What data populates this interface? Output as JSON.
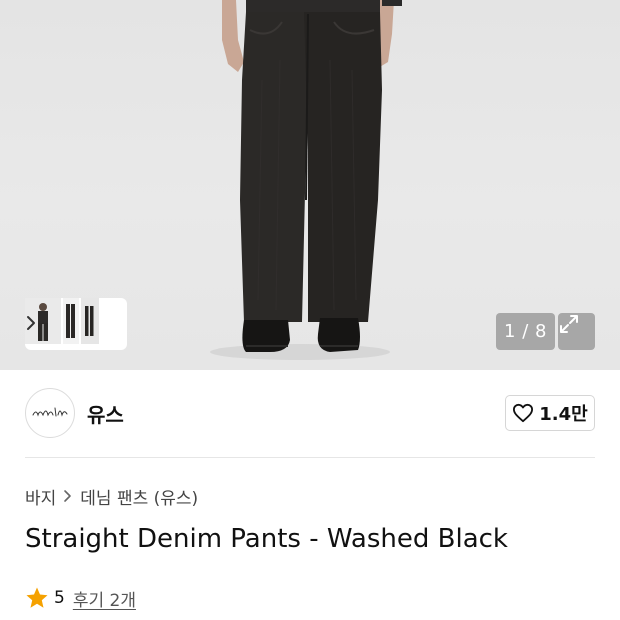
{
  "gallery": {
    "counter": "1 / 8"
  },
  "brand": {
    "logo_text": "nyouth",
    "name": "유스",
    "like_count": "1.4만"
  },
  "breadcrumb": {
    "category": "바지",
    "subcategory": "데님 팬츠 (유스)"
  },
  "product": {
    "title": "Straight Denim Pants - Washed Black"
  },
  "rating": {
    "score": "5",
    "reviews_label": "후기 2개"
  },
  "colors": {
    "star": "#F5A100",
    "text": "#111111",
    "muted": "#444444"
  },
  "icons": [
    "chevron-right-icon",
    "expand-icon",
    "heart-icon",
    "star-icon"
  ]
}
